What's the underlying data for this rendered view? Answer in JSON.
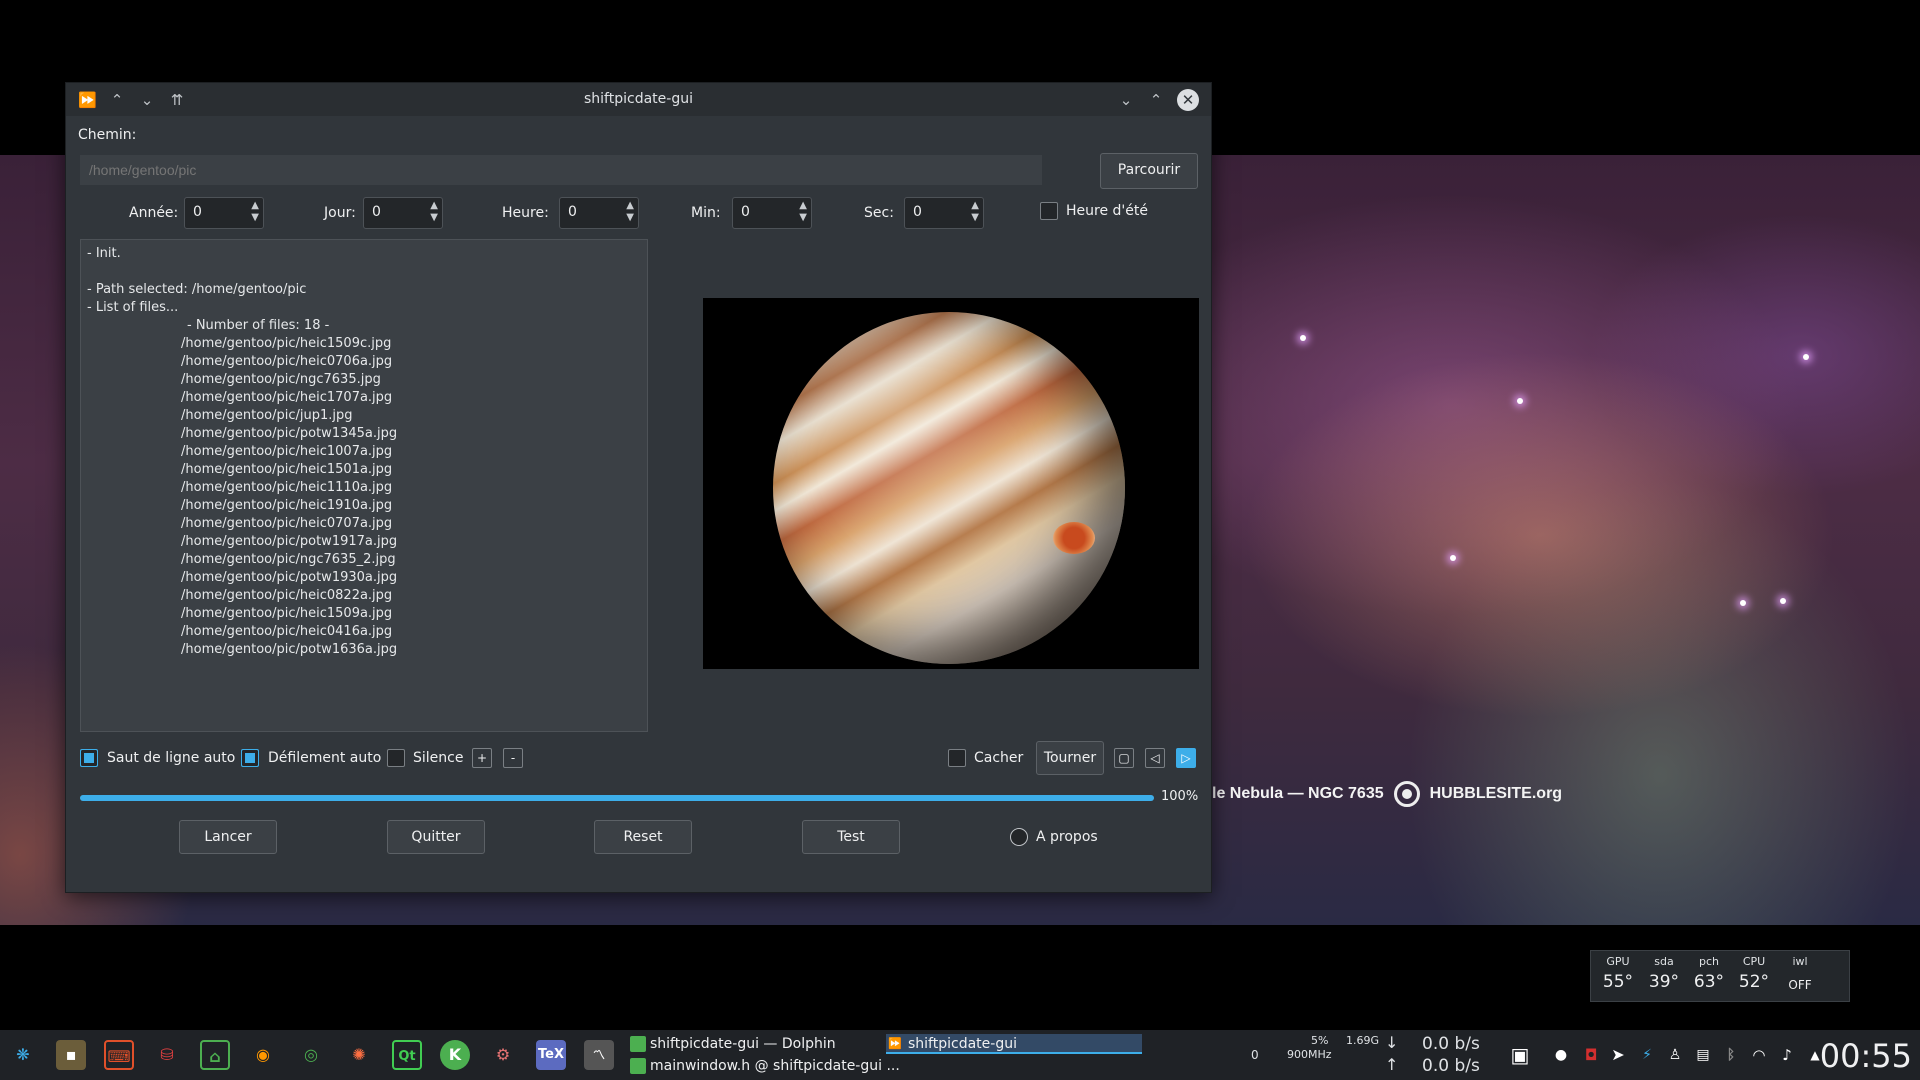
{
  "window": {
    "title": "shiftpicdate-gui"
  },
  "path": {
    "label": "Chemin:",
    "placeholder": "/home/gentoo/pic",
    "browse_label": "Parcourir"
  },
  "time_fields": [
    {
      "label": "Année:",
      "value": "0"
    },
    {
      "label": "Jour:",
      "value": "0"
    },
    {
      "label": "Heure:",
      "value": "0"
    },
    {
      "label": "Min:",
      "value": "0"
    },
    {
      "label": "Sec:",
      "value": "0"
    }
  ],
  "dst": {
    "label": "Heure d'été",
    "checked": false
  },
  "log": {
    "lines": [
      "- Init.",
      "",
      "- Path selected: /home/gentoo/pic",
      "- List of files..."
    ],
    "count_line": "- Number of files: 18 -",
    "files": [
      "/home/gentoo/pic/heic1509c.jpg",
      "/home/gentoo/pic/heic0706a.jpg",
      "/home/gentoo/pic/ngc7635.jpg",
      "/home/gentoo/pic/heic1707a.jpg",
      "/home/gentoo/pic/jup1.jpg",
      "/home/gentoo/pic/potw1345a.jpg",
      "/home/gentoo/pic/heic1007a.jpg",
      "/home/gentoo/pic/heic1501a.jpg",
      "/home/gentoo/pic/heic1110a.jpg",
      "/home/gentoo/pic/heic1910a.jpg",
      "/home/gentoo/pic/heic0707a.jpg",
      "/home/gentoo/pic/potw1917a.jpg",
      "/home/gentoo/pic/ngc7635_2.jpg",
      "/home/gentoo/pic/potw1930a.jpg",
      "/home/gentoo/pic/heic0822a.jpg",
      "/home/gentoo/pic/heic1509a.jpg",
      "/home/gentoo/pic/heic0416a.jpg",
      "/home/gentoo/pic/potw1636a.jpg"
    ]
  },
  "options": {
    "wrap_label": "Saut de ligne auto",
    "wrap_checked": true,
    "scroll_label": "Défilement auto",
    "scroll_checked": true,
    "silence_label": "Silence",
    "silence_checked": false,
    "plus_label": "+",
    "minus_label": "-",
    "hide_label": "Cacher",
    "hide_checked": false,
    "rotate_label": "Tourner",
    "nav_square": "▢",
    "nav_prev": "◁",
    "nav_next": "▷"
  },
  "progress": {
    "value": 1.0,
    "text": "100%"
  },
  "actions": {
    "run": "Lancer",
    "quit": "Quitter",
    "reset": "Reset",
    "test": "Test",
    "about": "A propos"
  },
  "wallpaper": {
    "caption_prefix": "le Nebula — NGC 7635",
    "caption_site": "HUBBLESITE.org"
  },
  "temps": [
    {
      "label": "GPU",
      "value": "55°"
    },
    {
      "label": "sda",
      "value": "39°"
    },
    {
      "label": "pch",
      "value": "63°"
    },
    {
      "label": "CPU",
      "value": "52°"
    },
    {
      "label": "iwl",
      "value": "OFF"
    }
  ],
  "taskbar": {
    "tasks": [
      "shiftpicdate-gui — Dolphin",
      "mainwindow.h @ shiftpicdate-gui ...",
      "shiftpicdate-gui"
    ],
    "cpu_count": "0",
    "cpu_percent": "5%",
    "cpu_freq": "900MHz",
    "mem": "1.69G",
    "net_down": "0.0 b/s",
    "net_up": "0.0 b/s",
    "clock": "00:55",
    "accent": "#3daee9"
  }
}
